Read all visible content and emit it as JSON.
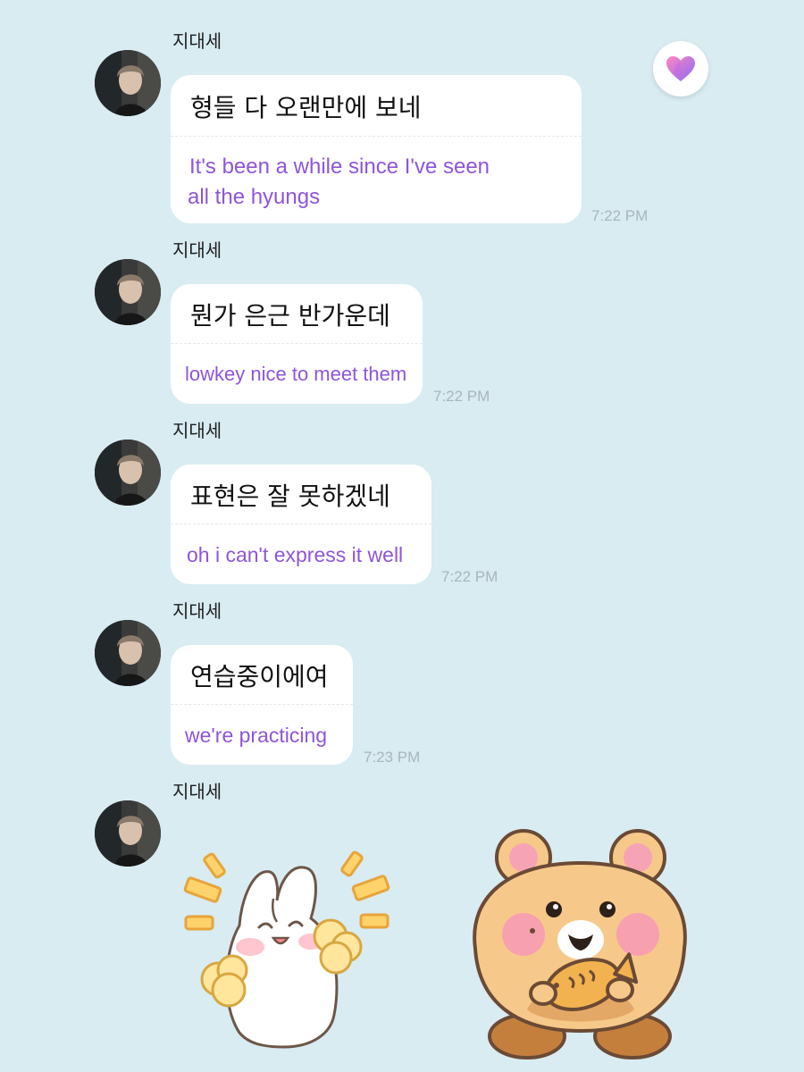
{
  "colors": {
    "background": "#d8ecf2",
    "bubble": "#ffffff",
    "translation_text": "#8f55d8",
    "timestamp": "#a9b6bb",
    "heart_gradient_start": "#ff86c4",
    "heart_gradient_end": "#8a6bf2"
  },
  "header": {
    "heart_icon": "heart-icon"
  },
  "messages": [
    {
      "sender": "지대세",
      "original": "형들 다 오랜만에 보네",
      "translation_line1": "It's been a while since I've seen",
      "translation_line2": "all the hyungs",
      "time": "7:22 PM"
    },
    {
      "sender": "지대세",
      "original": "뭔가 은근 반가운데",
      "translation": "lowkey nice to meet them",
      "time": "7:22 PM"
    },
    {
      "sender": "지대세",
      "original": "표현은 잘 못하겠네",
      "translation": "oh i can't express it well",
      "time": "7:22 PM"
    },
    {
      "sender": "지대세",
      "original": "연습중이에여",
      "translation": "we're practicing",
      "time": "7:23 PM"
    },
    {
      "sender": "지대세",
      "stickers": [
        "bunny-sticker",
        "hamster-sticker"
      ]
    }
  ]
}
